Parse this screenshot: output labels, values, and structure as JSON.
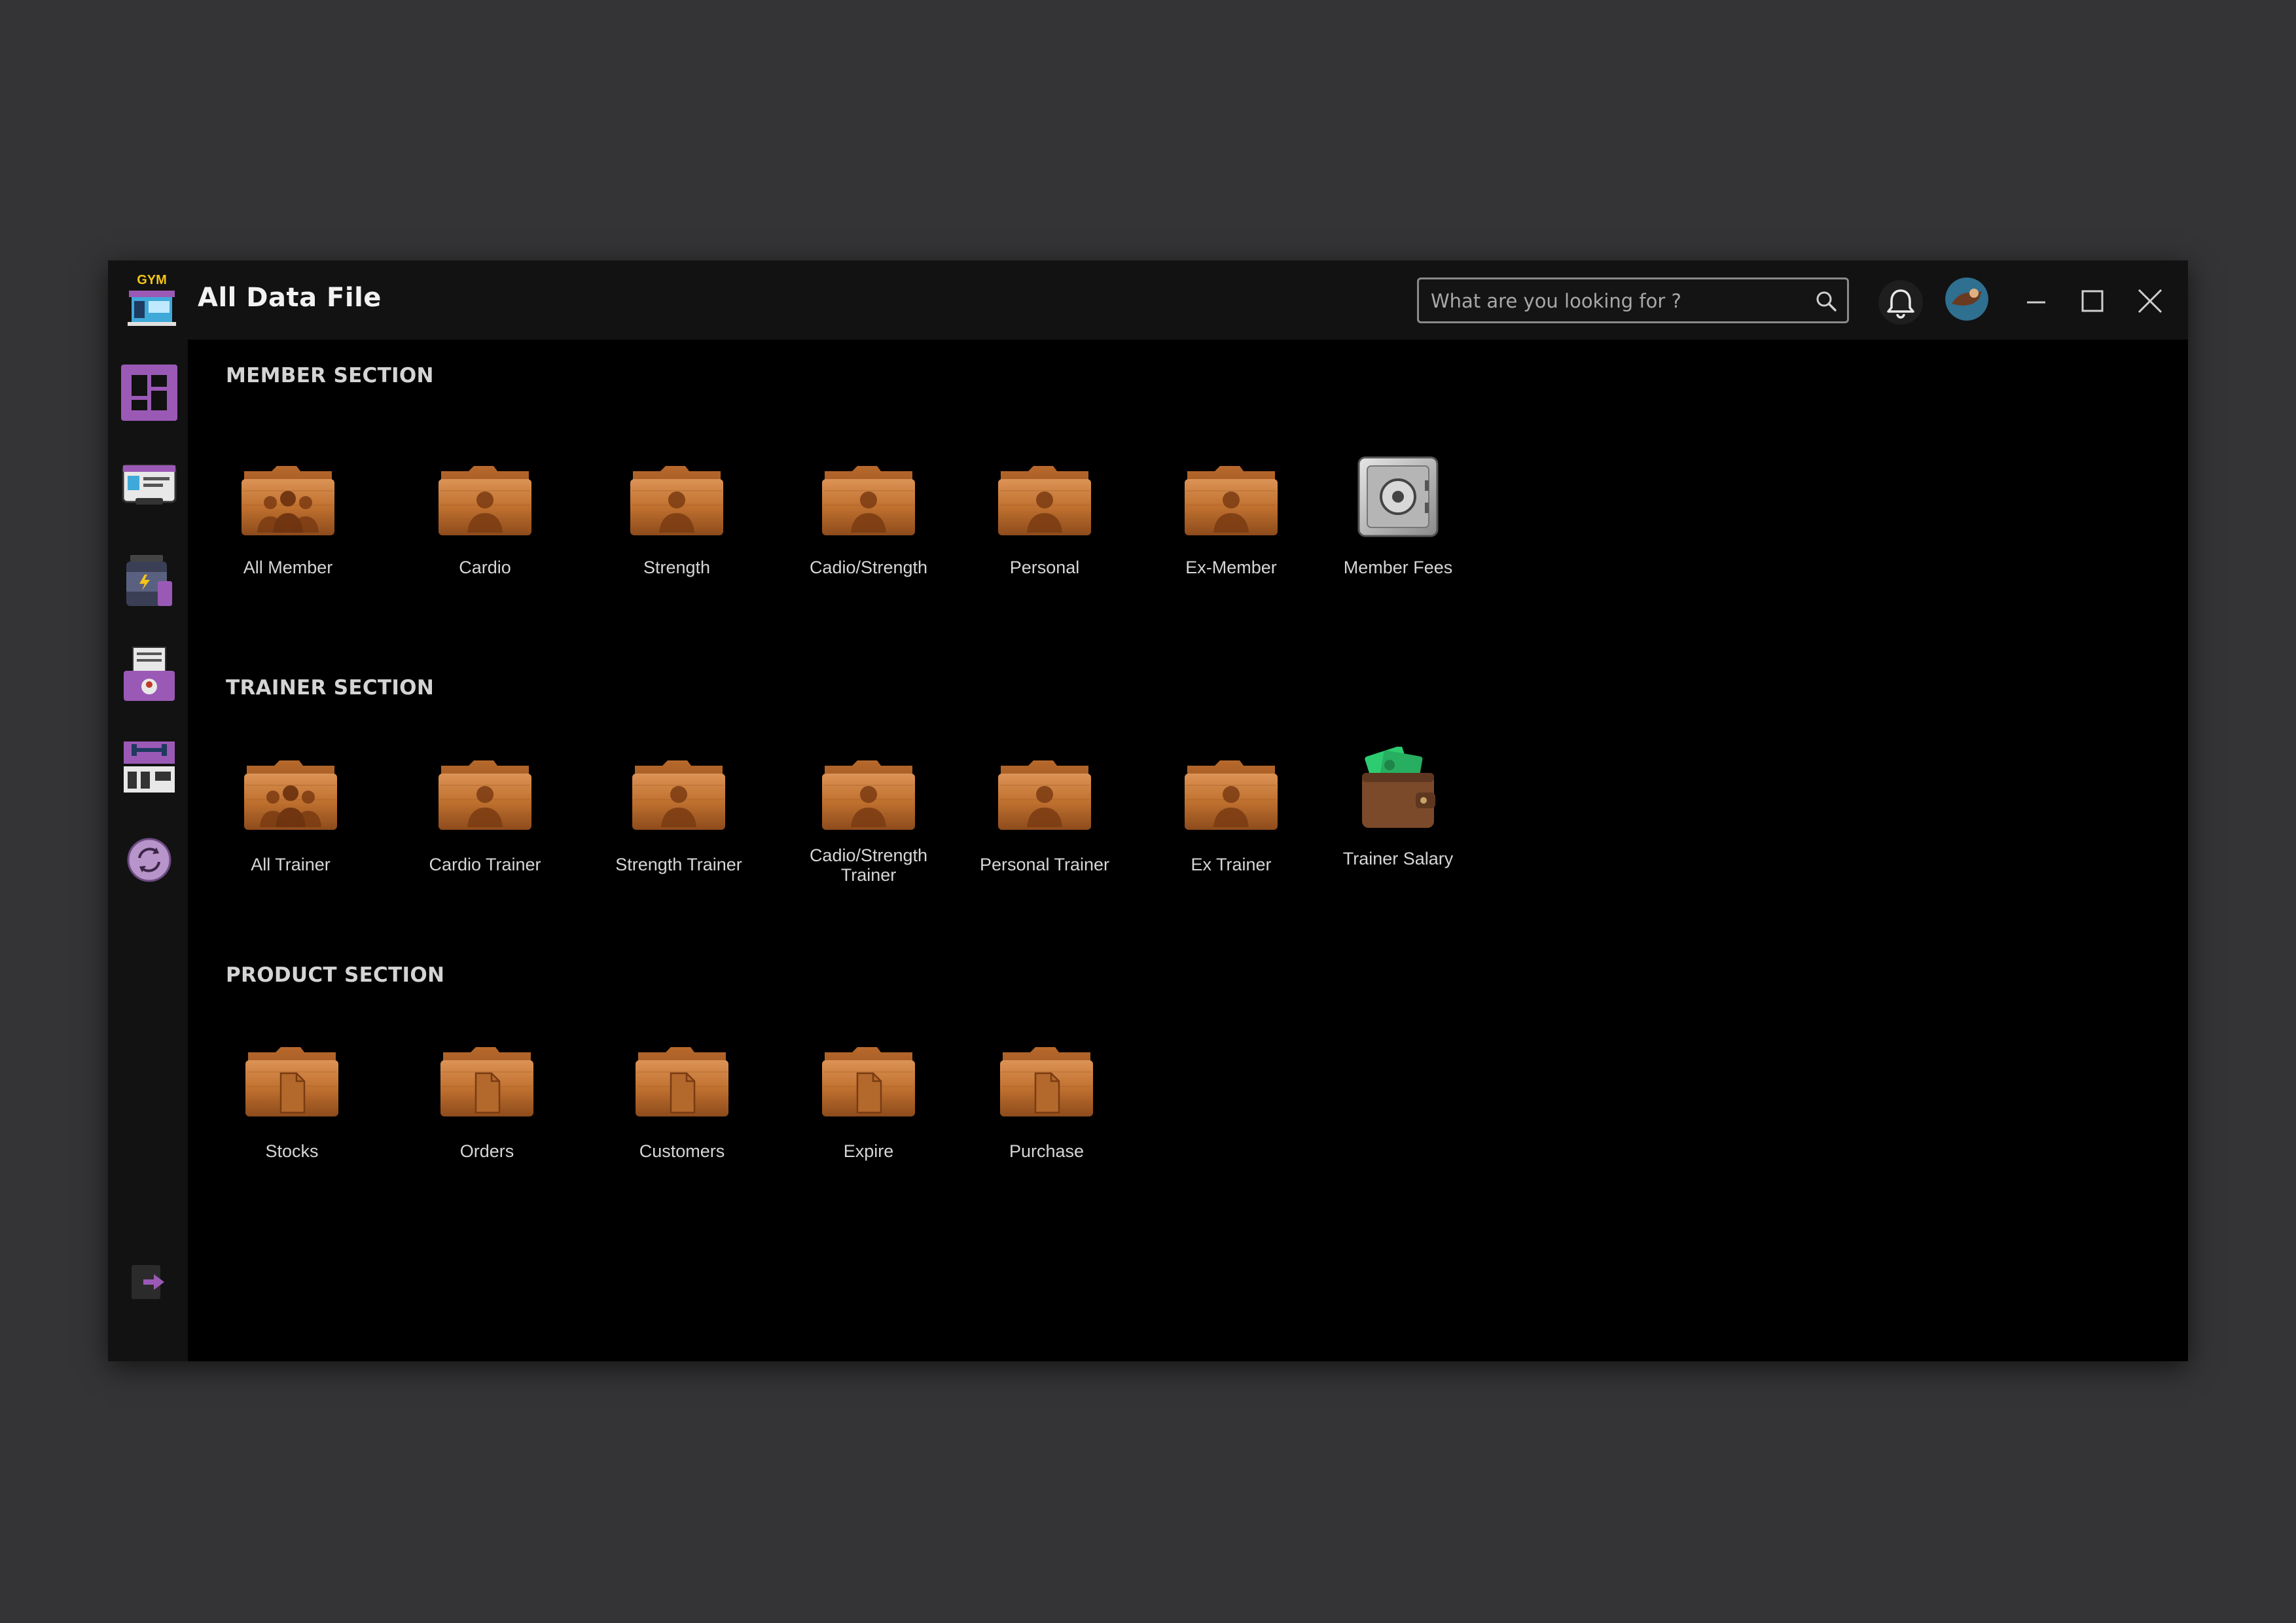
{
  "app": {
    "logo_text": "GYM",
    "title": "All Data File"
  },
  "search": {
    "placeholder": "What are you looking for ?"
  },
  "sections": {
    "member": {
      "title": "MEMBER SECTION",
      "items": [
        "All Member",
        "Cardio",
        "Strength",
        "Cadio/Strength",
        "Personal",
        "Ex-Member",
        "Member Fees"
      ]
    },
    "trainer": {
      "title": "TRAINER SECTION",
      "items": [
        "All Trainer",
        "Cardio Trainer",
        "Strength Trainer",
        "Cadio/Strength Trainer",
        "Personal Trainer",
        "Ex Trainer",
        "Trainer Salary"
      ]
    },
    "product": {
      "title": "PRODUCT SECTION",
      "items": [
        "Stocks",
        "Orders",
        "Customers",
        "Expire",
        "Purchase"
      ]
    }
  },
  "sidebar": {
    "items": [
      "dashboard-icon",
      "members-card-icon",
      "supplement-icon",
      "report-icon",
      "gym-equipment-icon",
      "sync-icon",
      "logout-icon"
    ]
  },
  "colors": {
    "accent": "#9b59b6",
    "folder": "#c47a3a",
    "background": "#000000",
    "desktop": "#343436"
  }
}
